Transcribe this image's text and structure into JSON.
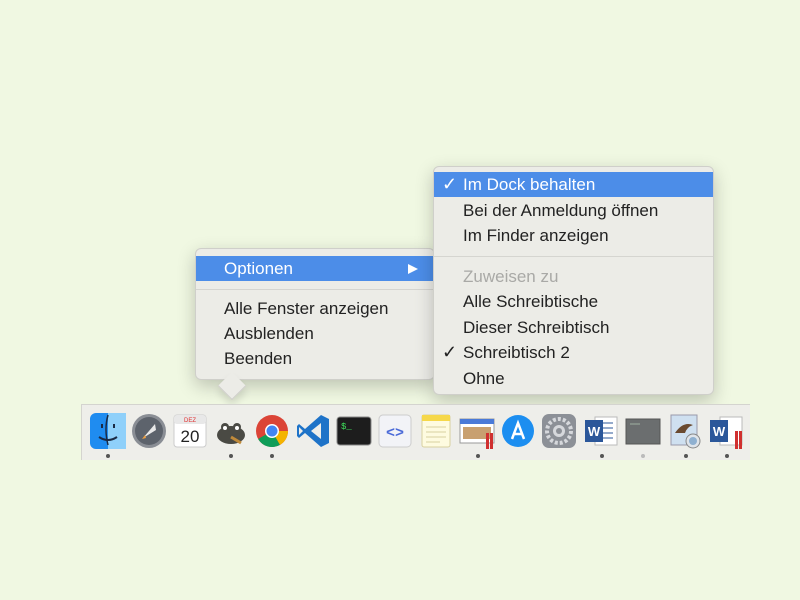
{
  "context_menu": {
    "options_label": "Optionen",
    "items": [
      "Alle Fenster anzeigen",
      "Ausblenden",
      "Beenden"
    ]
  },
  "submenu": {
    "keep_in_dock": "Im Dock behalten",
    "open_at_login": "Bei der Anmeldung öffnen",
    "show_in_finder": "Im Finder anzeigen",
    "assign_header": "Zuweisen zu",
    "assign_all": "Alle Schreibtische",
    "assign_this": "Dieser Schreibtisch",
    "assign_desktop2": "Schreibtisch 2",
    "assign_none": "Ohne",
    "checkmark": "✓"
  },
  "dock": {
    "calendar_month": "DEZ",
    "calendar_day": "20",
    "terminal_prompt": "$_",
    "xcode_glyph": "<>",
    "word_letter": "W",
    "icons": [
      "finder-icon",
      "launchpad-icon",
      "calendar-icon",
      "gimp-icon",
      "chrome-icon",
      "vscode-icon",
      "terminal-icon",
      "xcode-icon",
      "notes-icon",
      "preview-icon",
      "app-store-icon",
      "system-preferences-icon",
      "word-icon",
      "console-icon",
      "preview-eagle-icon",
      "word-document-icon"
    ]
  },
  "colors": {
    "background": "#f0f8e2",
    "highlight": "#4c8de8",
    "menu_bg": "#ecece7"
  }
}
